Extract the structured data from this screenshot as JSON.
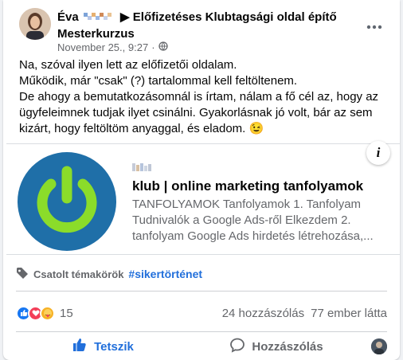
{
  "post": {
    "author_name": "Éva",
    "group_name": "Előfizetéses Klubtagsági oldal építő Mesterkurzus",
    "timestamp": "November 25., 9:27",
    "dot_separator": "·",
    "audience_icon": "globe-icon",
    "menu_icon": "more-dots-icon",
    "text_lines": [
      "Na, szóval ilyen lett az előfizetői oldalam.",
      "Működik, már \"csak\" (?) tartalommal kell feltöltenem.",
      "De ahogy a bemutatkozásomnál is írtam, nálam a fő cél az, hogy az ügyfeleimnek tudjak ilyet csinálni. Gyakorlásnak jó volt, bár az sem kizárt, hogy feltöltöm anyaggal, és eladom. 😉"
    ]
  },
  "link_preview": {
    "title": "klub | online marketing tanfolyamok",
    "description_line1": "TANFOLYAMOK Tanfolyamok 1. Tanfolyam",
    "description_line2": "Tudnivalók a Google Ads-ről Elkezdem 2.",
    "description_line3": "tanfolyam Google Ads hirdetés létrehozása,...",
    "info_label": "i",
    "thumbnail_icon": "power-icon",
    "thumb_bg_color": "#1f6fa8",
    "thumb_fg_color": "#8bdc2a"
  },
  "topics": {
    "label": "Csatolt témakörök",
    "tag": "#sikertörténet",
    "icon": "tag-icon"
  },
  "stats": {
    "reaction_count": "15",
    "comments": "24 hozzászólás",
    "views": "77 ember látta"
  },
  "actions": {
    "like_label": "Tetszik",
    "comment_label": "Hozzászólás"
  },
  "colors": {
    "accent_blue": "#216fdb",
    "secondary_text": "#65676b"
  }
}
